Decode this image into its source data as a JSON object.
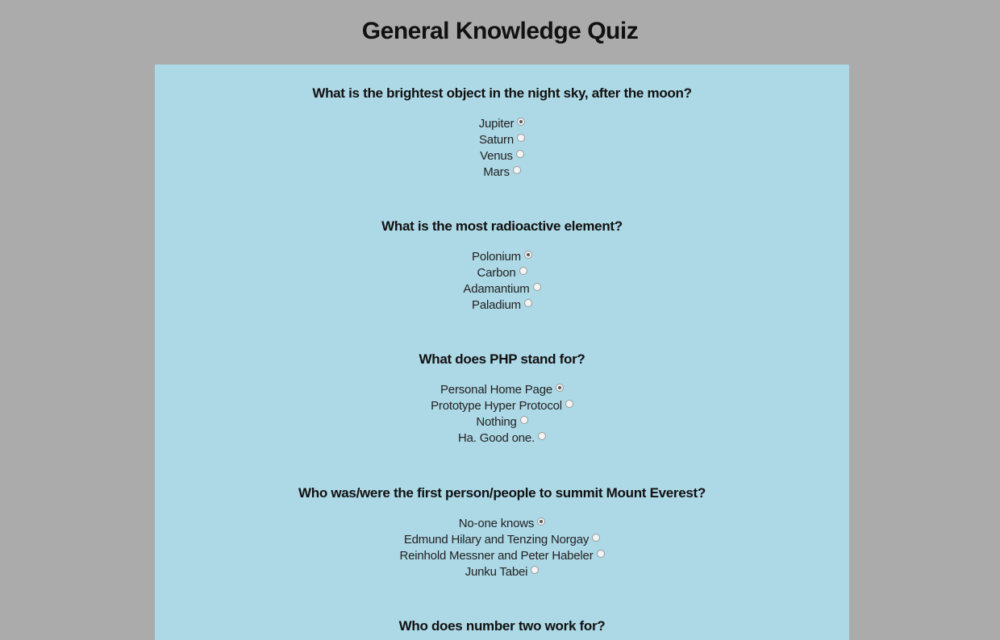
{
  "page": {
    "title": "General Knowledge Quiz"
  },
  "questions": [
    {
      "text": "What is the brightest object in the night sky, after the moon?",
      "options": [
        "Jupiter",
        "Saturn",
        "Venus",
        "Mars"
      ],
      "selected_index": 0
    },
    {
      "text": "What is the most radioactive element?",
      "options": [
        "Polonium",
        "Carbon",
        "Adamantium",
        "Paladium"
      ],
      "selected_index": 0
    },
    {
      "text": "What does PHP stand for?",
      "options": [
        "Personal Home Page",
        "Prototype Hyper Protocol",
        "Nothing",
        "Ha. Good one."
      ],
      "selected_index": 0
    },
    {
      "text": "Who was/were the first person/people to summit Mount Everest?",
      "options": [
        "No-one knows",
        "Edmund Hilary and Tenzing Norgay",
        "Reinhold Messner and Peter Habeler",
        "Junku Tabei"
      ],
      "selected_index": 0
    },
    {
      "text": "Who does number two work for?",
      "options": [],
      "selected_index": null
    }
  ],
  "colors": {
    "background": "#ababab",
    "panel": "#add8e6"
  }
}
